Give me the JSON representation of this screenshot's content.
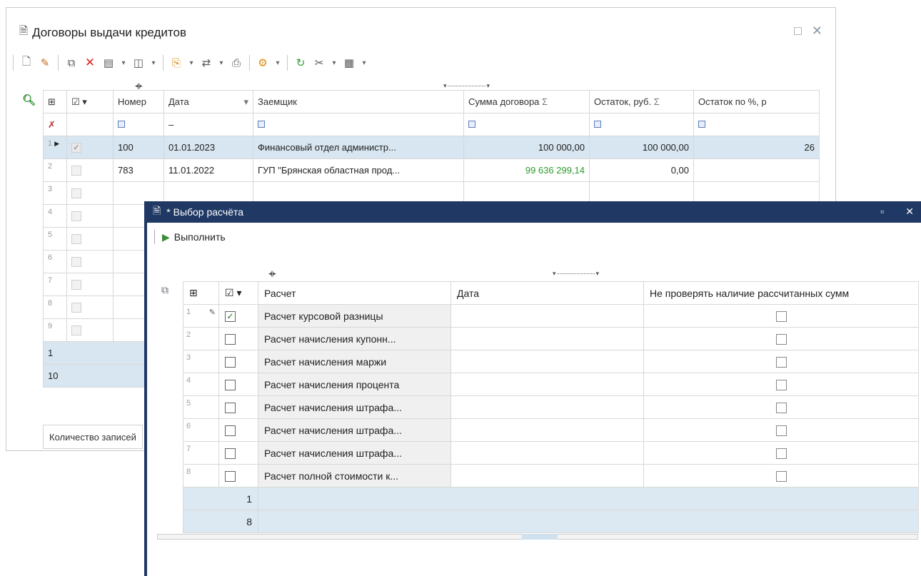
{
  "main": {
    "title": "Договоры выдачи кредитов",
    "columns": [
      "Номер",
      "Дата",
      "Заемщик",
      "Сумма договора",
      "Остаток, руб.",
      "Остаток по %, р"
    ],
    "sigma": "Σ",
    "rows": [
      {
        "n": "1",
        "num": "100",
        "date": "01.01.2023",
        "borrower": "Финансовый отдел администр...",
        "sum": "100 000,00",
        "rest": "100 000,00",
        "restp": "26"
      },
      {
        "n": "2",
        "num": "783",
        "date": "11.01.2022",
        "borrower": "ГУП \"Брянская областная прод...",
        "sum": "99 636 299,14",
        "rest": "0,00",
        "restp": ""
      },
      {
        "n": "3",
        "num": "",
        "date": "",
        "borrower": "",
        "sum": "",
        "rest": "",
        "restp": ""
      },
      {
        "n": "4",
        "num": "",
        "date": "",
        "borrower": "",
        "sum": "",
        "rest": "",
        "restp": ""
      },
      {
        "n": "5",
        "num": "",
        "date": "",
        "borrower": "",
        "sum": "",
        "rest": "",
        "restp": ""
      },
      {
        "n": "6",
        "num": "",
        "date": "",
        "borrower": "",
        "sum": "",
        "rest": "",
        "restp": ""
      },
      {
        "n": "7",
        "num": "",
        "date": "",
        "borrower": "",
        "sum": "",
        "rest": "",
        "restp": ""
      },
      {
        "n": "8",
        "num": "",
        "date": "",
        "borrower": "",
        "sum": "",
        "rest": "",
        "restp": ""
      },
      {
        "n": "9",
        "num": "",
        "date": "",
        "borrower": "",
        "sum": "",
        "rest": "",
        "restp": ""
      }
    ],
    "summary": [
      "1",
      "10"
    ],
    "status": "Количество записей"
  },
  "dialog": {
    "title": "* Выбор расчёта",
    "run_label": "Выполнить",
    "columns": [
      "Расчет",
      "Дата",
      "Не проверять наличие рассчитанных сумм"
    ],
    "rows": [
      {
        "n": "1",
        "name": "Расчет курсовой разницы"
      },
      {
        "n": "2",
        "name": "Расчет начисления купонн..."
      },
      {
        "n": "3",
        "name": "Расчет начисления маржи"
      },
      {
        "n": "4",
        "name": "Расчет начисления процента"
      },
      {
        "n": "5",
        "name": "Расчет начисления штрафа..."
      },
      {
        "n": "6",
        "name": "Расчет начисления штрафа..."
      },
      {
        "n": "7",
        "name": "Расчет начисления штрафа..."
      },
      {
        "n": "8",
        "name": "Расчет полной стоимости к..."
      }
    ],
    "summary": [
      "1",
      "8"
    ]
  }
}
